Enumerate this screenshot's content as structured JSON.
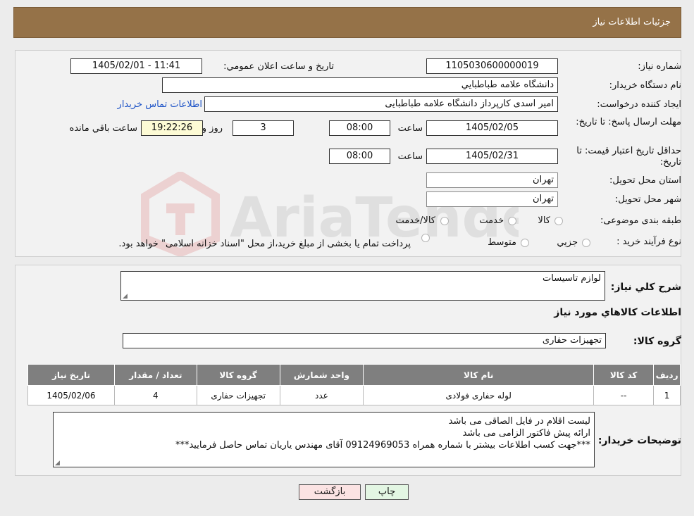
{
  "header": {
    "title": "جزئیات اطلاعات نیاز"
  },
  "details": {
    "need_number_label": "شماره نیاز:",
    "need_number": "1105030600000019",
    "announce_label": "تاریخ و ساعت اعلان عمومي:",
    "announce_value": "1405/02/01 - 11:41",
    "buyer_org_label": "نام دستگاه خريدار:",
    "buyer_org": "دانشگاه علامه طباطبايي",
    "creator_label": "ايجاد کننده درخواست:",
    "creator": "امیر اسدی کارپرداز دانشگاه علامه طباطبایی",
    "contact_link": "اطلاعات تماس خريدار",
    "deadline_label": "مهلت ارسال پاسخ: تا تاريخ:",
    "deadline_date": "1405/02/05",
    "time_label": "ساعت",
    "deadline_time": "08:00",
    "days_value": "3",
    "days_label": "روز و",
    "remaining_time": "19:22:26",
    "remaining_label": "ساعت باقي مانده",
    "validity_label": "حداقل تاريخ اعتبار قيمت: تا تاريخ:",
    "validity_date": "1405/02/31",
    "validity_time": "08:00",
    "province_label": "استان محل تحويل:",
    "province": "تهران",
    "city_label": "شهر محل تحويل:",
    "city": "تهران",
    "category_label": "طبقه بندی موضوعی:",
    "category_options": [
      "کالا",
      "خدمت",
      "کالا/خدمت"
    ],
    "process_label": "نوع فرآيند خريد :",
    "process_options": [
      "جزيي",
      "متوسط"
    ],
    "process_note": "پرداخت تمام يا بخشی از مبلغ خريد،از محل \"اسناد خزانه اسلامی\" خواهد بود."
  },
  "needs": {
    "summary_label": "شرح کلي نياز:",
    "summary_value": "لوازم تاسیسات",
    "items_title": "اطلاعات کالاهاي مورد نياز",
    "group_label": "گروه کالا:",
    "group_value": "تجهیزات حفاری",
    "table": {
      "headers": [
        "رديف",
        "کد کالا",
        "نام کالا",
        "واحد شمارش",
        "گروه کالا",
        "تعداد / مقدار",
        "تاريخ نياز"
      ],
      "rows": [
        [
          "1",
          "--",
          "لوله حفاری فولادی",
          "عدد",
          "تجهیزات حفاری",
          "4",
          "1405/02/06"
        ]
      ]
    },
    "buyer_notes_label": "توضيحات خريدار:",
    "buyer_notes": [
      "لیست اقلام در فایل الصاقی می باشد",
      "ارائه پیش فاکتور الزامی می باشد",
      "***جهت کسب اطلاعات بیشتر با شماره همراه 09124969053 آقای مهندس یاریان تماس حاصل فرمایید***"
    ]
  },
  "buttons": {
    "print": "چاپ",
    "back": "بازگشت"
  },
  "colors": {
    "header_bg": "#957248",
    "remaining_bg": "#fdfbd5",
    "back_button_bg": "#fbe3e3",
    "print_button_bg": "#e3f6e3",
    "table_header_bg": "#7f7f7f"
  }
}
